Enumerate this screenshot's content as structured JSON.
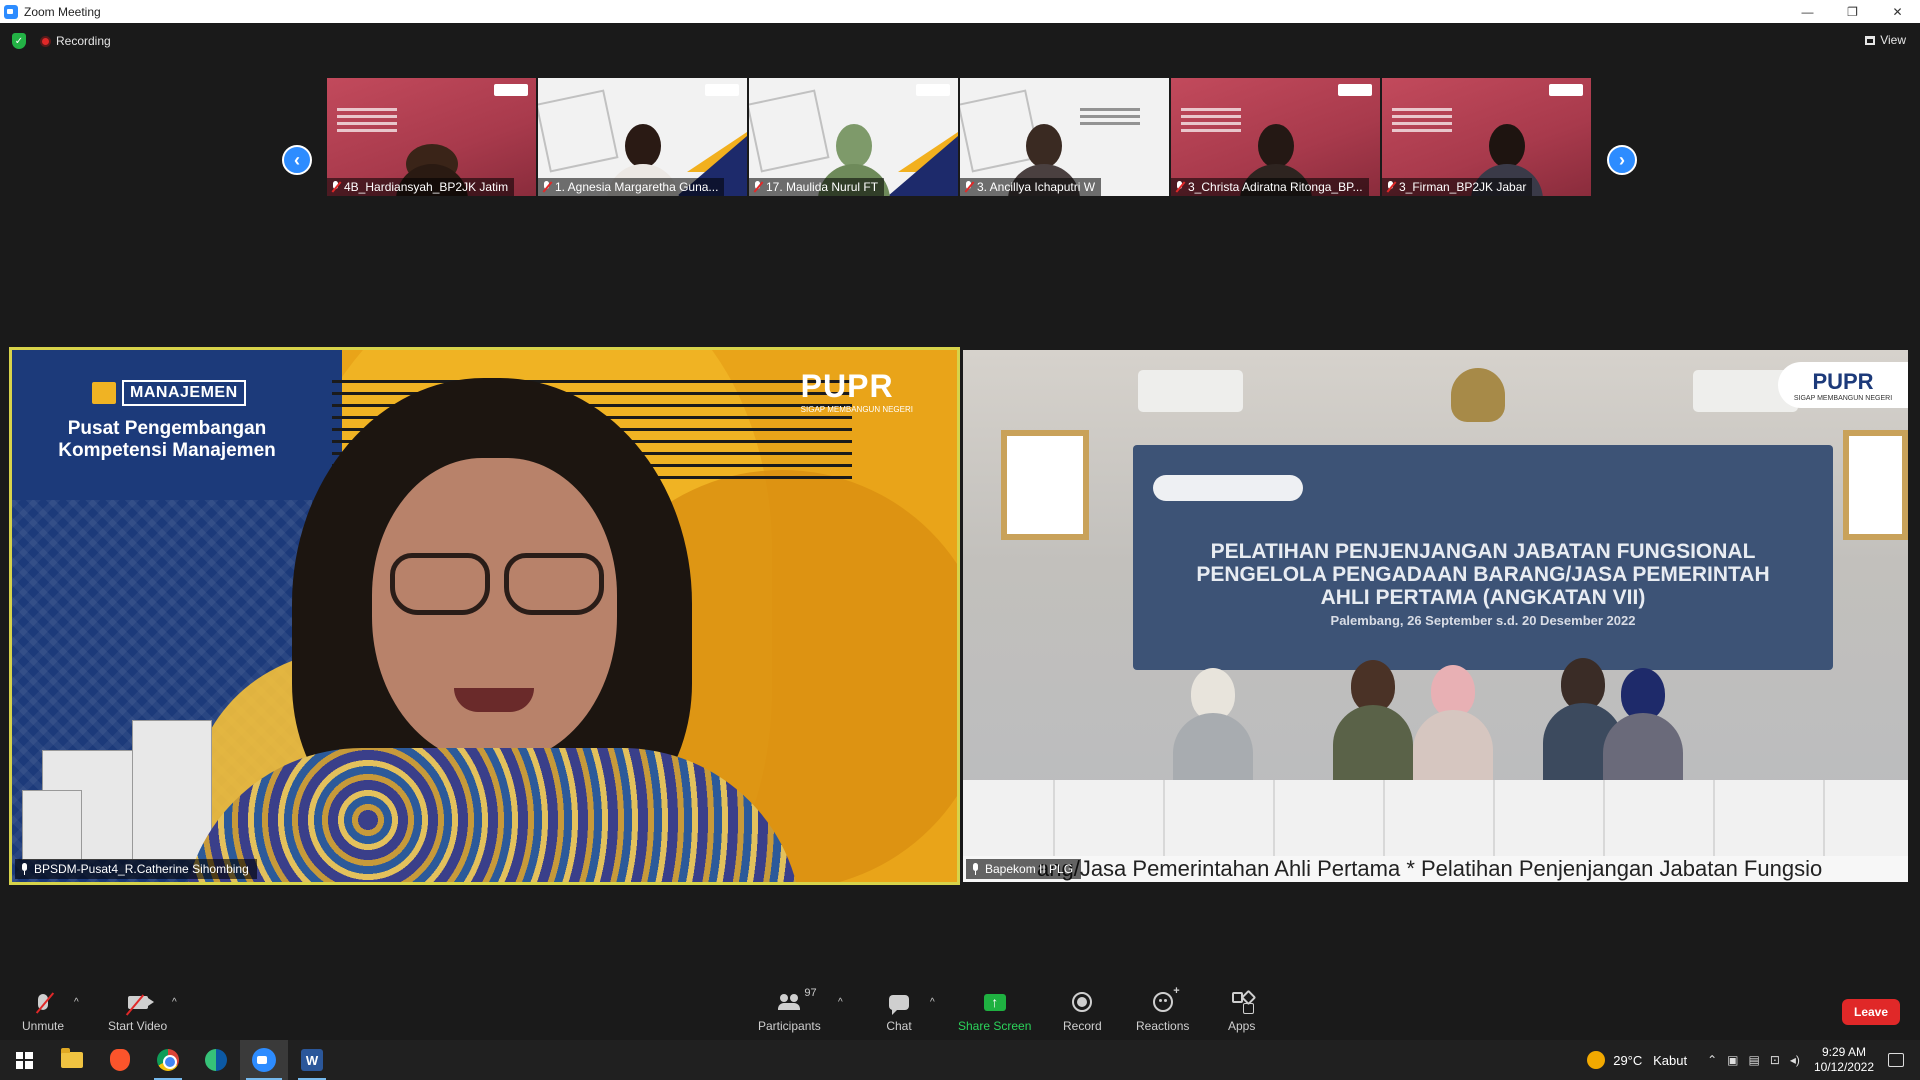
{
  "window": {
    "title": "Zoom Meeting",
    "controls": {
      "minimize": "—",
      "restore": "❐",
      "close": "✕"
    }
  },
  "meeting_header": {
    "recording_label": "Recording",
    "view_label": "View"
  },
  "thumbnails": [
    {
      "name": "4B_Hardiansyah_BP2JK Jatim",
      "muted": true
    },
    {
      "name": "1. Agnesia Margaretha Guna...",
      "muted": true
    },
    {
      "name": "17. Maulida Nurul FT",
      "muted": true
    },
    {
      "name": "3. Ancillya Ichaputri W",
      "muted": true
    },
    {
      "name": "3_Christa Adiratna Ritonga_BP...",
      "muted": true
    },
    {
      "name": "3_Firman_BP2JK Jabar",
      "muted": true
    }
  ],
  "nav": {
    "prev": "‹",
    "next": "›"
  },
  "tiles": {
    "left": {
      "name": "BPSDM-Pusat4_R.Catherine Sihombing",
      "bg_logo": "MANAJEMEN",
      "bg_heading": "Pusat Pengembangan Kompetensi Manajemen",
      "bg_brand": "PUPR",
      "bg_brand_tagline": "SIGAP MEMBANGUN NEGERI"
    },
    "right": {
      "name": "Bapekom II PLG",
      "banner_line1": "PELATIHAN PENJENJANGAN JABATAN FUNGSIONAL",
      "banner_line2": "PENGELOLA PENGADAAN BARANG/JASA PEMERINTAH",
      "banner_line3": "AHLI PERTAMA (ANGKATAN VII)",
      "banner_line4": "Palembang, 26 September s.d. 20 Desember 2022",
      "brand": "PUPR",
      "brand_tagline": "SIGAP MEMBANGUN NEGERI",
      "ticker": "ang/Jasa Pemerintahan Ahli Pertama * Pelatihan Penjenjangan Jabatan Fungsio"
    }
  },
  "toolbar": {
    "unmute": "Unmute",
    "start_video": "Start Video",
    "participants": "Participants",
    "participants_count": "97",
    "chat": "Chat",
    "share_screen": "Share Screen",
    "record": "Record",
    "reactions": "Reactions",
    "apps": "Apps",
    "leave": "Leave",
    "caret": "^"
  },
  "taskbar": {
    "weather_temp": "29°C",
    "weather_desc": "Kabut",
    "time": "9:29 AM",
    "date": "10/12/2022",
    "word_letter": "W"
  },
  "colors": {
    "accent": "#2d8cff",
    "leave": "#e02828",
    "share": "#1fb141",
    "speaker_border": "#d7d34a"
  }
}
